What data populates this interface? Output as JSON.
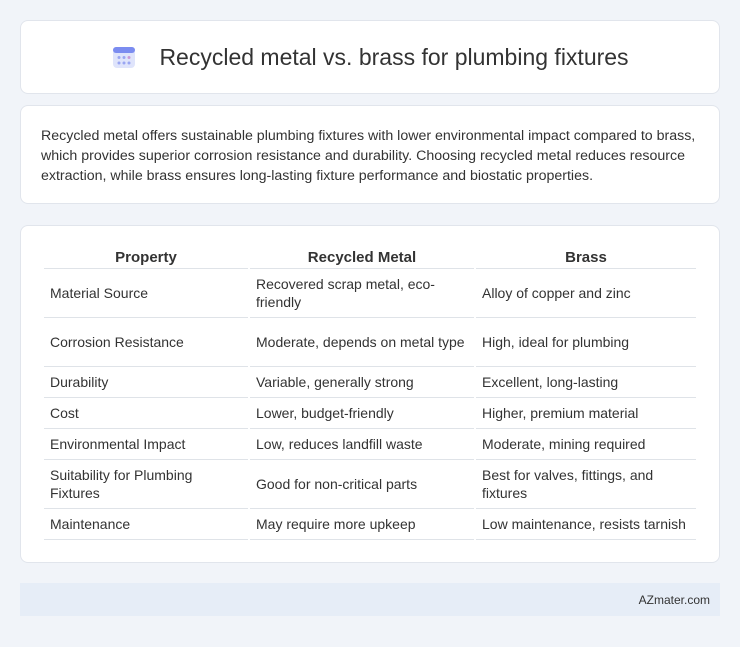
{
  "header": {
    "title": "Recycled metal vs. brass for plumbing fixtures",
    "icon": "calendar-icon"
  },
  "summary": {
    "text": "Recycled metal offers sustainable plumbing fixtures with lower environmental impact compared to brass, which provides superior corrosion resistance and durability. Choosing recycled metal reduces resource extraction, while brass ensures long-lasting fixture performance and biostatic properties."
  },
  "table": {
    "headers": [
      "Property",
      "Recycled Metal",
      "Brass"
    ],
    "rows": [
      [
        "Material Source",
        "Recovered scrap metal, eco-friendly",
        "Alloy of copper and zinc"
      ],
      [
        "Corrosion Resistance",
        "Moderate, depends on metal type",
        "High, ideal for plumbing"
      ],
      [
        "Durability",
        "Variable, generally strong",
        "Excellent, long-lasting"
      ],
      [
        "Cost",
        "Lower, budget-friendly",
        "Higher, premium material"
      ],
      [
        "Environmental Impact",
        "Low, reduces landfill waste",
        "Moderate, mining required"
      ],
      [
        "Suitability for Plumbing Fixtures",
        "Good for non-critical parts",
        "Best for valves, fittings, and fixtures"
      ],
      [
        "Maintenance",
        "May require more upkeep",
        "Low maintenance, resists tarnish"
      ]
    ]
  },
  "footer": {
    "brand": "AZmater.com"
  },
  "colors": {
    "background": "#f1f4f9",
    "card": "#ffffff",
    "footer": "#e6edf7",
    "icon_accent": "#7b8cf0"
  }
}
